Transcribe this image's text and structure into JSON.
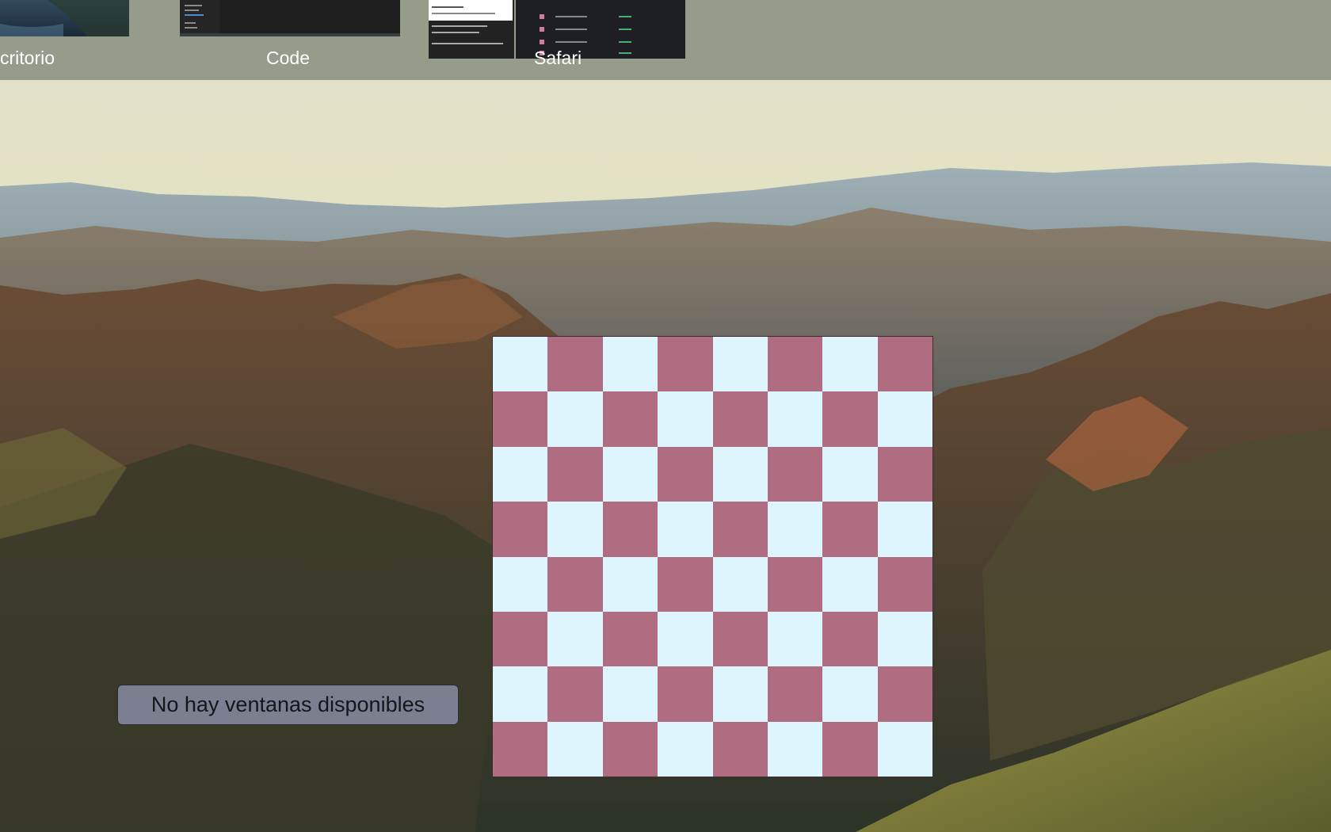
{
  "spaces": [
    {
      "label": "critorio"
    },
    {
      "label": "Code"
    },
    {
      "label": "Safari"
    }
  ],
  "tooltip": {
    "text": "No hay ventanas disponibles"
  },
  "board": {
    "light_color": "#def5fe",
    "dark_color": "#b06c81"
  },
  "colors": {
    "spaces_bar": "#959c8a"
  }
}
